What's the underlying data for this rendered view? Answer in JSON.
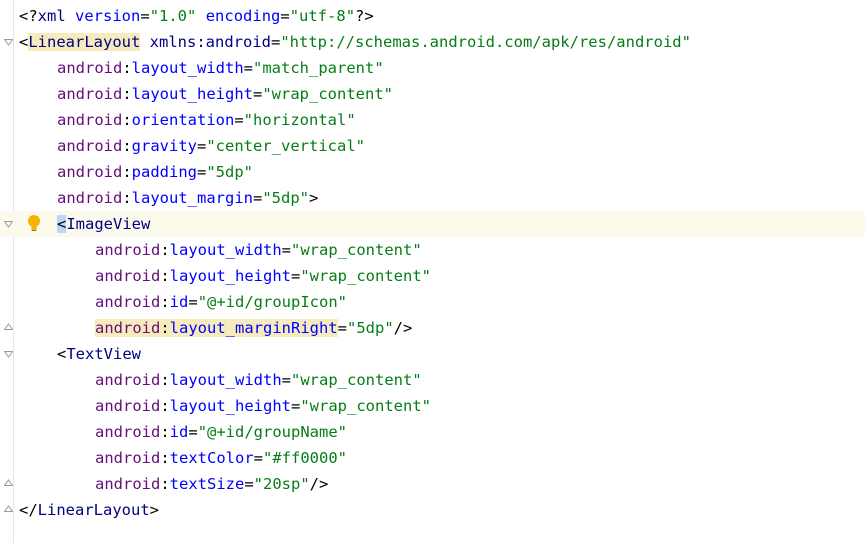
{
  "editor": {
    "language": "xml",
    "lines": [
      {
        "indent": 0,
        "type": "pi",
        "open": "<?",
        "name": "xml",
        "attrs": [
          {
            "name": "version",
            "value": "\"1.0\""
          },
          {
            "name": "encoding",
            "value": "\"utf-8\""
          }
        ],
        "close": "?>"
      },
      {
        "indent": 0,
        "type": "open",
        "open": "<",
        "tag": "LinearLayout",
        "highlight": true,
        "extra_name": "xmlns:android",
        "extra_eq": "=",
        "extra_value": "\"http://schemas.android.com/apk/res/android\""
      },
      {
        "indent": 1,
        "ns": "android",
        "name": "layout_width",
        "value": "\"match_parent\""
      },
      {
        "indent": 1,
        "ns": "android",
        "name": "layout_height",
        "value": "\"wrap_content\""
      },
      {
        "indent": 1,
        "ns": "android",
        "name": "orientation",
        "value": "\"horizontal\""
      },
      {
        "indent": 1,
        "ns": "android",
        "name": "gravity",
        "value": "\"center_vertical\""
      },
      {
        "indent": 1,
        "ns": "android",
        "name": "padding",
        "value": "\"5dp\""
      },
      {
        "indent": 1,
        "ns": "android",
        "name": "layout_margin",
        "value": "\"5dp\"",
        "suffix": ">"
      },
      {
        "indent": 1,
        "type": "open",
        "open": "<",
        "tag": "ImageView",
        "current": true
      },
      {
        "indent": 2,
        "ns": "android",
        "name": "layout_width",
        "value": "\"wrap_content\""
      },
      {
        "indent": 2,
        "ns": "android",
        "name": "layout_height",
        "value": "\"wrap_content\""
      },
      {
        "indent": 2,
        "ns": "android",
        "name": "id",
        "value": "\"@+id/groupIcon\""
      },
      {
        "indent": 2,
        "ns": "android",
        "name": "layout_marginRight",
        "value": "\"5dp\"",
        "suffix": "/>",
        "highlight": true
      },
      {
        "indent": 1,
        "type": "open",
        "open": "<",
        "tag": "TextView"
      },
      {
        "indent": 2,
        "ns": "android",
        "name": "layout_width",
        "value": "\"wrap_content\""
      },
      {
        "indent": 2,
        "ns": "android",
        "name": "layout_height",
        "value": "\"wrap_content\""
      },
      {
        "indent": 2,
        "ns": "android",
        "name": "id",
        "value": "\"@+id/groupName\""
      },
      {
        "indent": 2,
        "ns": "android",
        "name": "textColor",
        "value": "\"#ff0000\""
      },
      {
        "indent": 2,
        "ns": "android",
        "name": "textSize",
        "value": "\"20sp\"",
        "suffix": "/>"
      },
      {
        "indent": 0,
        "type": "close",
        "open": "</",
        "tag": "LinearLayout",
        "close": ">"
      }
    ]
  },
  "colors": {
    "tag": "#000080",
    "attr_prefix": "#660e7a",
    "attr_name": "#0000ff",
    "value": "#067d17",
    "current_line": "#fcfaed",
    "match_highlight": "#f6ebbc",
    "caret_box": "#bcd7f8",
    "bulb": "#f5b400"
  },
  "icons": {
    "fold": "fold-marker-icon",
    "intention": "lightbulb-icon"
  }
}
